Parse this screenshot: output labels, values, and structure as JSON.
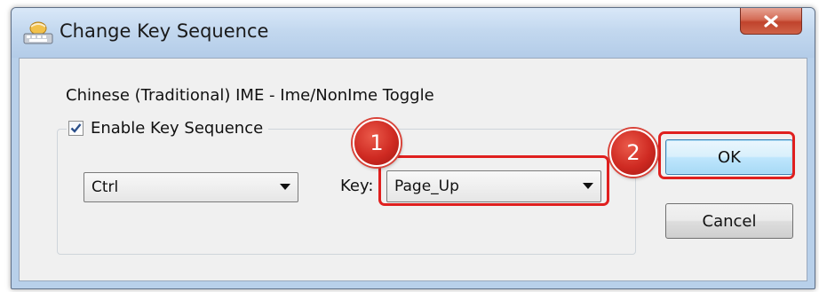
{
  "window": {
    "title": "Change Key Sequence",
    "icon": "keyboard-icon",
    "close_icon": "close-icon"
  },
  "dialog": {
    "description": "Chinese (Traditional) IME - Ime/NonIme Toggle",
    "enable_checkbox": {
      "label": "Enable Key Sequence",
      "checked": true
    },
    "modifier_combo": {
      "value": "Ctrl"
    },
    "key_label": "Key:",
    "key_combo": {
      "value": "Page_Up"
    },
    "ok_label": "OK",
    "cancel_label": "Cancel"
  },
  "annotations": {
    "badge_1": "1",
    "badge_2": "2",
    "highlight_color": "#e0201f"
  }
}
